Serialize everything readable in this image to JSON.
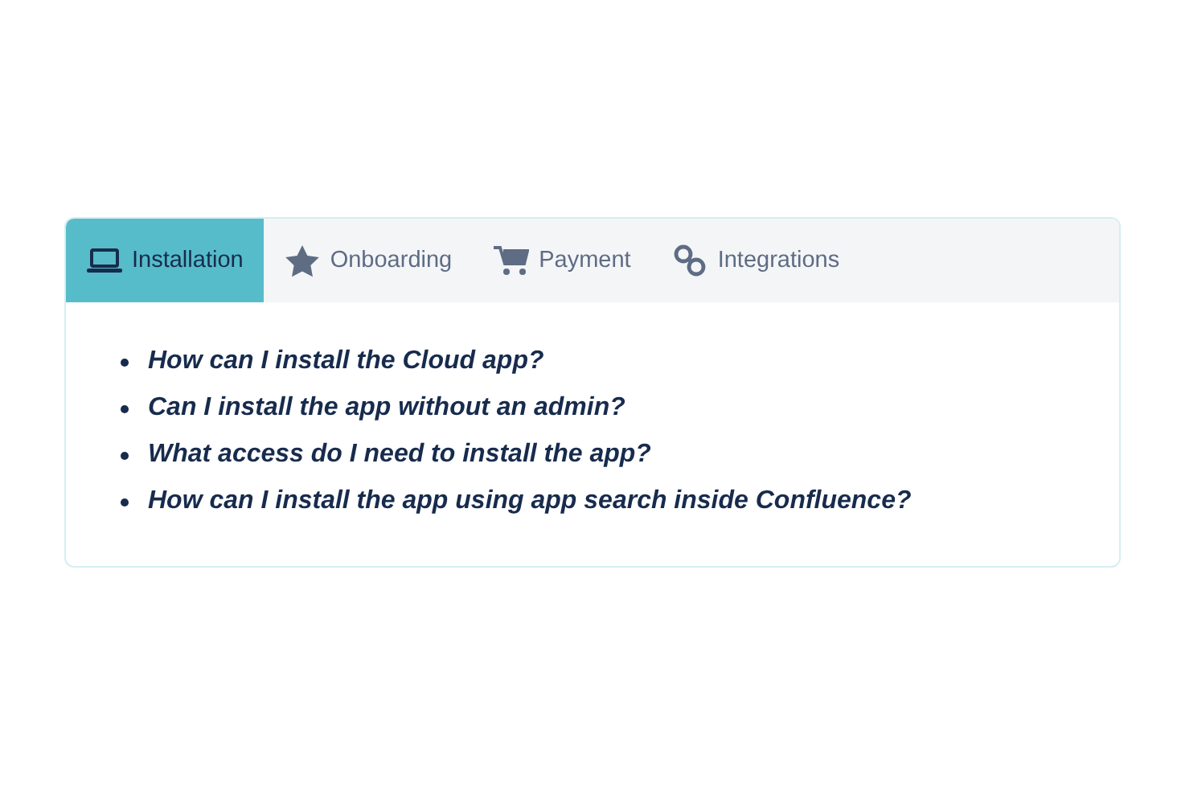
{
  "tabs": [
    {
      "label": "Installation",
      "selected": true
    },
    {
      "label": "Onboarding",
      "selected": false
    },
    {
      "label": "Payment",
      "selected": false
    },
    {
      "label": "Integrations",
      "selected": false
    }
  ],
  "questions": [
    "How can I install the Cloud app?",
    "Can I install the app without an admin?",
    "What access do I need to install the app?",
    "How can I install the app using app search inside Confluence?"
  ]
}
